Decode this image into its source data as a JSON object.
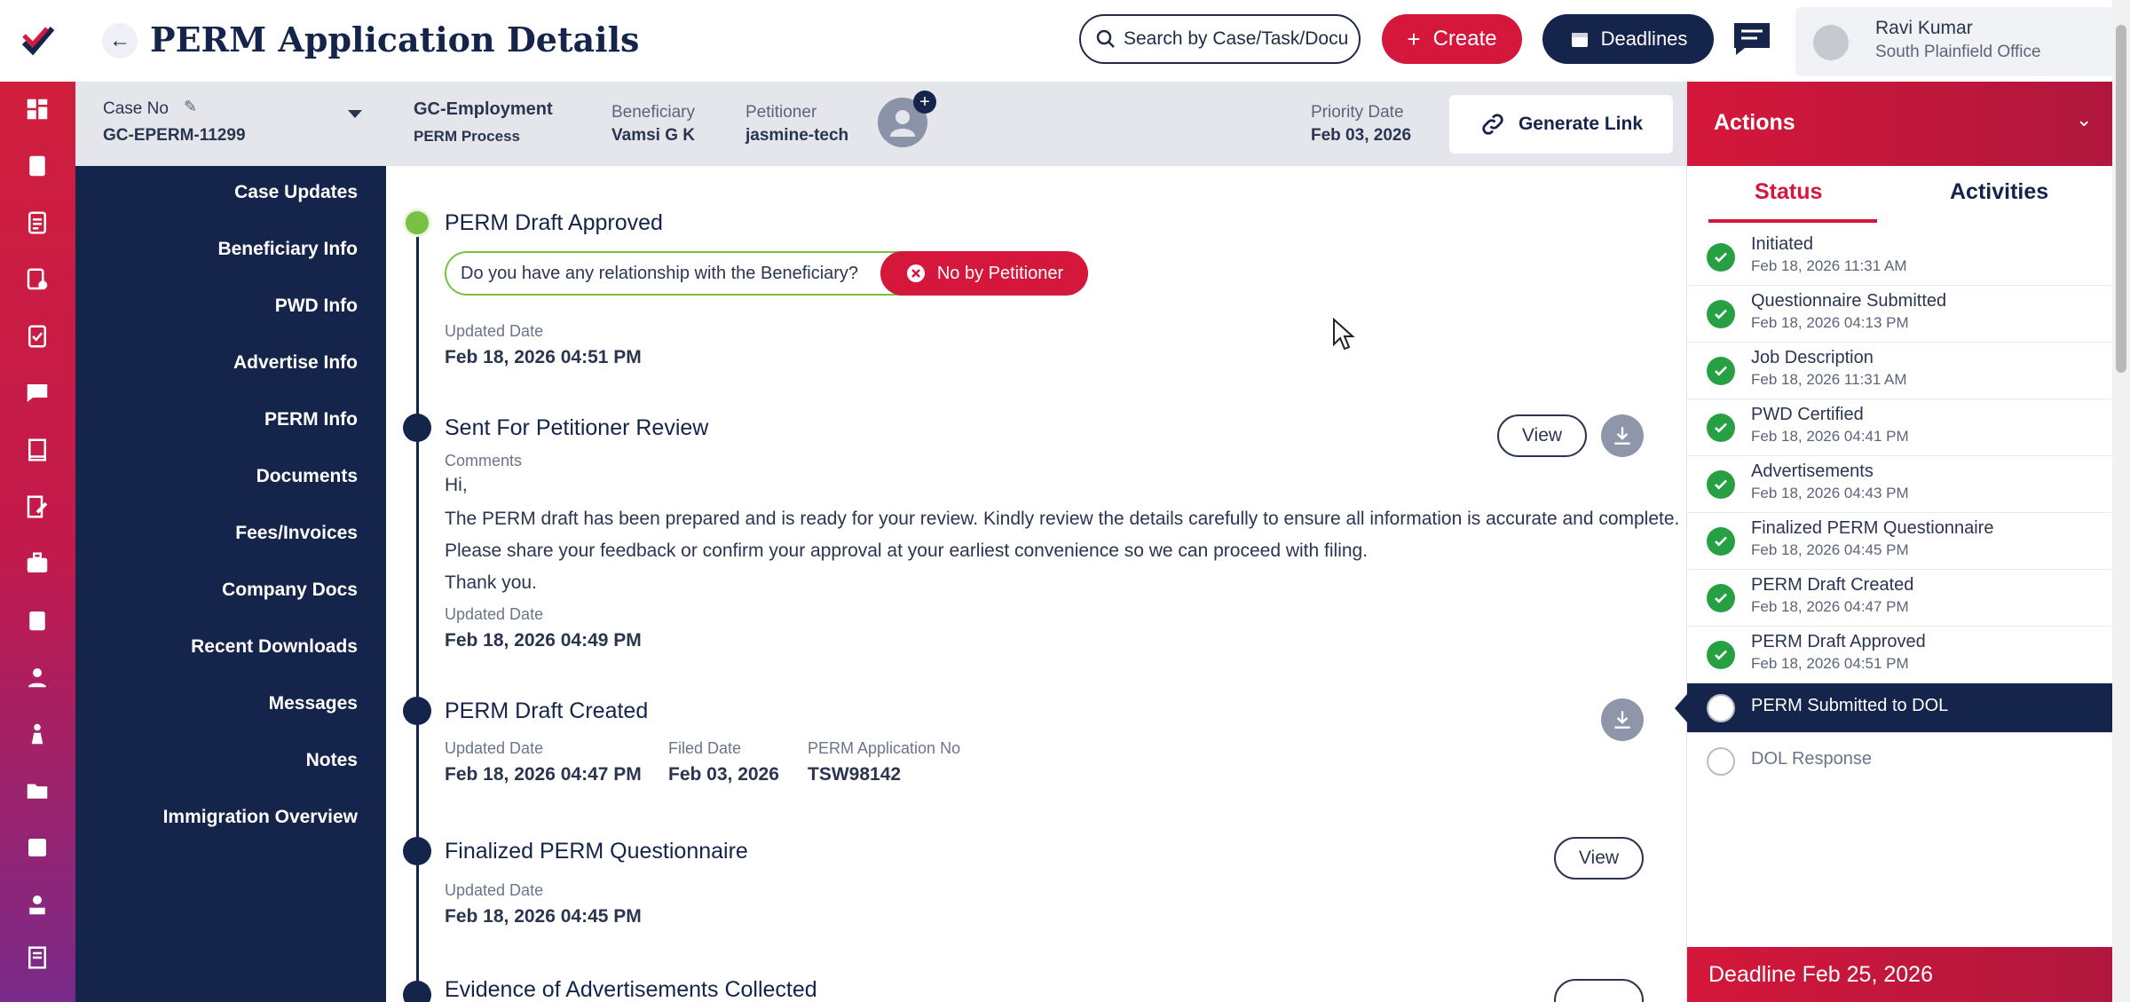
{
  "header": {
    "title": "PERM Application Details",
    "search_placeholder": "Search by Case/Task/Docu",
    "create_label": "Create",
    "deadlines_label": "Deadlines",
    "user_name": "Ravi Kumar",
    "user_office": "South Plainfield Office"
  },
  "case": {
    "case_no_label": "Case No",
    "case_no": "GC-EPERM-11299",
    "type": "GC-Employment",
    "process": "PERM Process",
    "beneficiary_label": "Beneficiary",
    "beneficiary": "Vamsi G K",
    "petitioner_label": "Petitioner",
    "petitioner": "jasmine-tech",
    "priority_label": "Priority Date",
    "priority_date": "Feb 03, 2026",
    "generate_link": "Generate Link"
  },
  "nav": {
    "items": [
      "Case Updates",
      "Beneficiary Info",
      "PWD Info",
      "Advertise Info",
      "PERM Info",
      "Documents",
      "Fees/Invoices",
      "Company Docs",
      "Recent Downloads",
      "Messages",
      "Notes",
      "Immigration Overview"
    ]
  },
  "timeline": {
    "e1": {
      "title": "PERM Draft Approved",
      "question": "Do you have any relationship with the Beneficiary?",
      "answer": "No by Petitioner",
      "updated_label": "Updated Date",
      "updated": "Feb 18, 2026 04:51 PM"
    },
    "e2": {
      "title": "Sent For Petitioner Review",
      "comments_label": "Comments",
      "line1": "Hi,",
      "line2": "The PERM draft has been prepared and is ready for your review. Kindly review the details carefully to ensure all information is accurate and complete.",
      "line3": "Please share your feedback or confirm your approval at your earliest convenience so we can proceed with filing.",
      "line4": "Thank you.",
      "updated_label": "Updated Date",
      "updated": "Feb 18, 2026 04:49 PM",
      "view": "View"
    },
    "e3": {
      "title": "PERM Draft Created",
      "updated_label": "Updated Date",
      "updated": "Feb 18, 2026 04:47 PM",
      "filed_label": "Filed Date",
      "filed": "Feb 03, 2026",
      "app_no_label": "PERM Application No",
      "app_no": "TSW98142"
    },
    "e4": {
      "title": "Finalized PERM Questionnaire",
      "updated_label": "Updated Date",
      "updated": "Feb 18, 2026 04:45 PM",
      "view": "View"
    },
    "e5": {
      "title": "Evidence of Advertisements Collected"
    }
  },
  "panel": {
    "title": "Actions",
    "tab_status": "Status",
    "tab_activities": "Activities",
    "statuses": [
      {
        "name": "Initiated",
        "date": "Feb 18, 2026 11:31 AM"
      },
      {
        "name": "Questionnaire Submitted",
        "date": "Feb 18, 2026 04:13 PM"
      },
      {
        "name": "Job Description",
        "date": "Feb 18, 2026 11:31 AM"
      },
      {
        "name": "PWD Certified",
        "date": "Feb 18, 2026 04:41 PM"
      },
      {
        "name": "Advertisements",
        "date": "Feb 18, 2026 04:43 PM"
      },
      {
        "name": "Finalized PERM Questionnaire",
        "date": "Feb 18, 2026 04:45 PM"
      },
      {
        "name": "PERM Draft Created",
        "date": "Feb 18, 2026 04:47 PM"
      },
      {
        "name": "PERM Draft Approved",
        "date": "Feb 18, 2026 04:51 PM"
      },
      {
        "name": "PERM Submitted to DOL",
        "date": ""
      },
      {
        "name": "DOL Response",
        "date": ""
      }
    ],
    "deadline": "Deadline Feb 25, 2026"
  },
  "colors": {
    "brand_red": "#d4173a",
    "navy": "#15244a",
    "success": "#27a043",
    "approved": "#7ac143"
  }
}
